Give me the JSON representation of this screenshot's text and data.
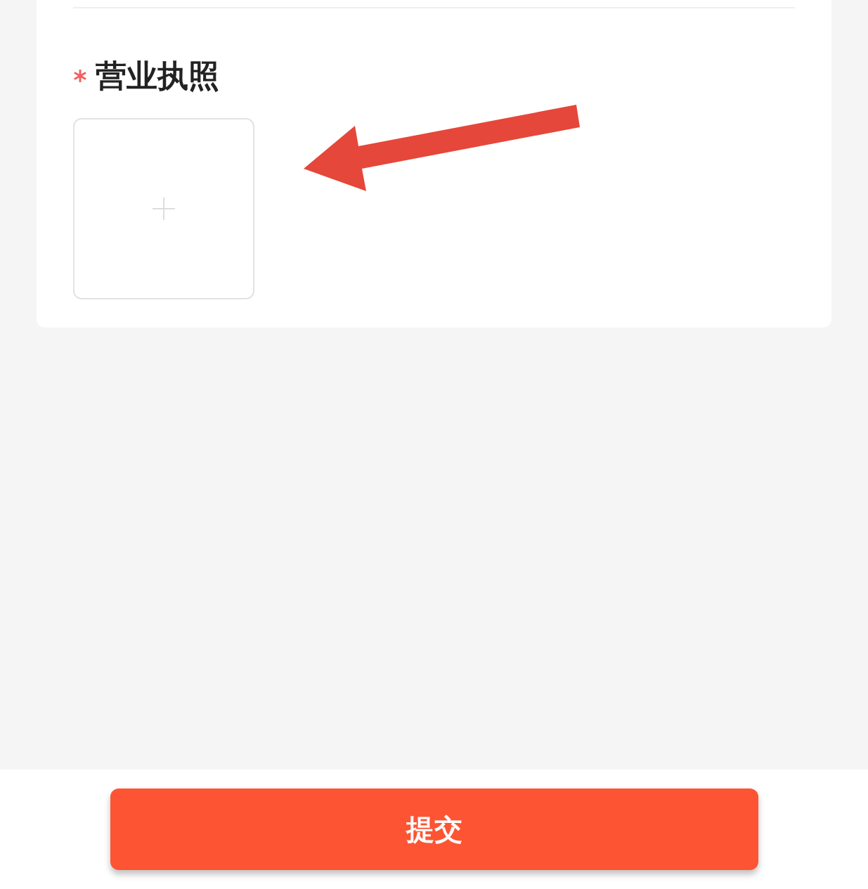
{
  "form": {
    "fields": [
      {
        "label": "营业执照",
        "required": true,
        "kind": "upload"
      }
    ]
  },
  "submit_button": {
    "label": "提交"
  }
}
